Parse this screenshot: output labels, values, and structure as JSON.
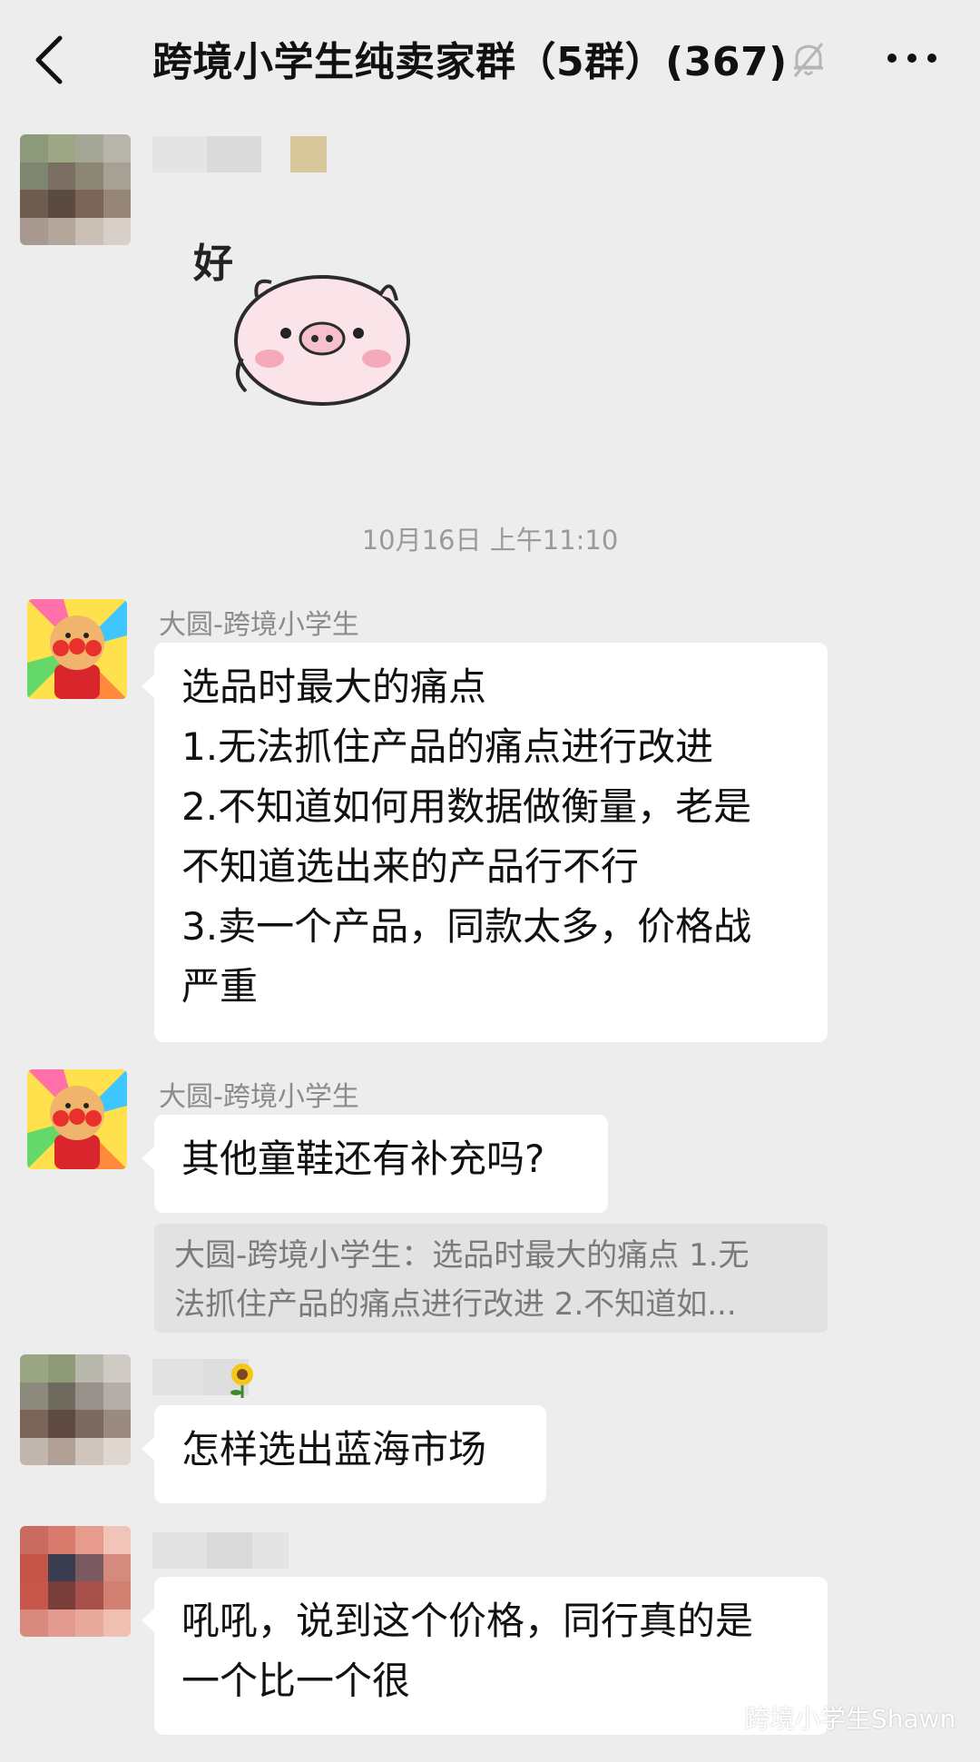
{
  "header": {
    "title": "跨境小学生纯卖家群（5群）(367)",
    "back_icon": "chevron-left-icon",
    "mute_icon": "bell-off-icon",
    "more_icon": "more-dots-icon"
  },
  "messages": {
    "sticker": {
      "text": "好"
    },
    "timestamp": "10月16日 上午11:10",
    "msg1": {
      "sender": "大圆-跨境小学生",
      "lines": [
        "选品时最大的痛点",
        "1.无法抓住产品的痛点进行改进",
        "2.不知道如何用数据做衡量，老是",
        "不知道选出来的产品行不行",
        "3.卖一个产品，同款太多，价格战",
        "严重"
      ]
    },
    "msg2": {
      "sender": "大圆-跨境小学生",
      "text": "其他童鞋还有补充吗?",
      "quote_lines": [
        "大圆-跨境小学生：选品时最大的痛点 1.无",
        "法抓住产品的痛点进行改进 2.不知道如..."
      ]
    },
    "msg3": {
      "text": "怎样选出蓝海市场"
    },
    "msg4": {
      "lines": [
        "吼吼，说到这个价格，同行真的是",
        "一个比一个很"
      ]
    }
  },
  "watermark": "跨境小学生Shawn",
  "colors": {
    "background": "#ededed",
    "bubble": "#ffffff",
    "quote": "#e2e2e2"
  }
}
